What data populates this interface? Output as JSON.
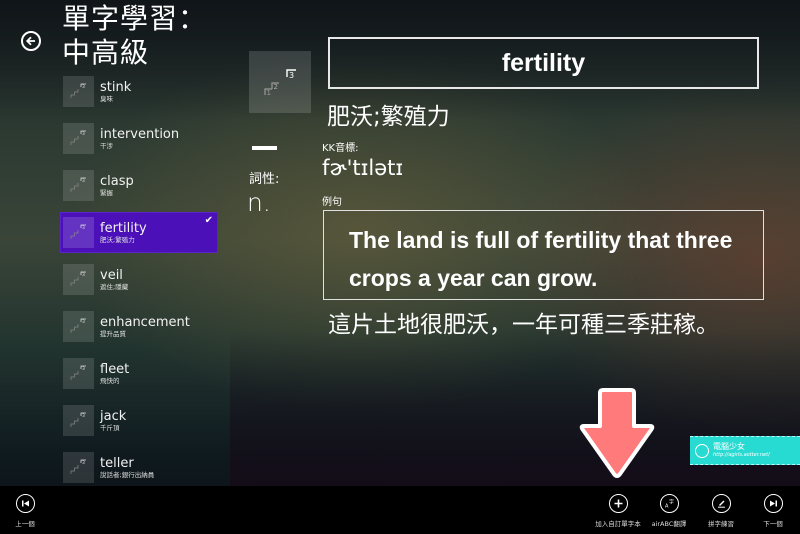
{
  "header": {
    "title_line1": "單字學習：",
    "title_line2": "中高級",
    "back_icon": "back-arrow-icon"
  },
  "word_list": [
    {
      "word": "stink",
      "meaning": "臭味",
      "selected": false
    },
    {
      "word": "intervention",
      "meaning": "干涉",
      "selected": false
    },
    {
      "word": "clasp",
      "meaning": "緊握",
      "selected": false
    },
    {
      "word": "fertility",
      "meaning": "肥沃;繁殖力",
      "selected": true
    },
    {
      "word": "veil",
      "meaning": "遮住;隱藏",
      "selected": false
    },
    {
      "word": "enhancement",
      "meaning": "提升品質",
      "selected": false
    },
    {
      "word": "fleet",
      "meaning": "飛快的",
      "selected": false
    },
    {
      "word": "jack",
      "meaning": "千斤頂",
      "selected": false
    },
    {
      "word": "teller",
      "meaning": "說話者;銀行出納員",
      "selected": false
    }
  ],
  "detail": {
    "level_badge": "3",
    "level_steps": [
      "1",
      "2",
      "3"
    ],
    "pos_label": "詞性:",
    "pos_value": "n.",
    "word": "fertility",
    "meaning": "肥沃;繁殖力",
    "kk_label": "KK音標:",
    "kk_value": "fɚ'tɪlətɪ",
    "example_label": "例句",
    "example_en": "The land is full of fertility that three crops a year can grow.",
    "example_zh": "這片土地很肥沃，一年可種三季莊稼。"
  },
  "watermark": {
    "name": "電腦少女",
    "url": "http://agirls.aotter.net/"
  },
  "appbar": {
    "prev": {
      "label": "上一個",
      "icon": "skip-previous-icon"
    },
    "add_wordbook": {
      "label": "加入自訂單字本",
      "icon": "plus-icon"
    },
    "translate": {
      "label": "airABC翻譯",
      "icon": "translate-icon"
    },
    "spelling": {
      "label": "拼字練習",
      "icon": "pen-icon"
    },
    "next": {
      "label": "下一個",
      "icon": "skip-next-icon"
    }
  },
  "colors": {
    "selected_item": "#4b10b8",
    "annotation_arrow": "#ff7b7b",
    "watermark_bg": "#28dbd2",
    "appbar_bg": "#000000"
  }
}
